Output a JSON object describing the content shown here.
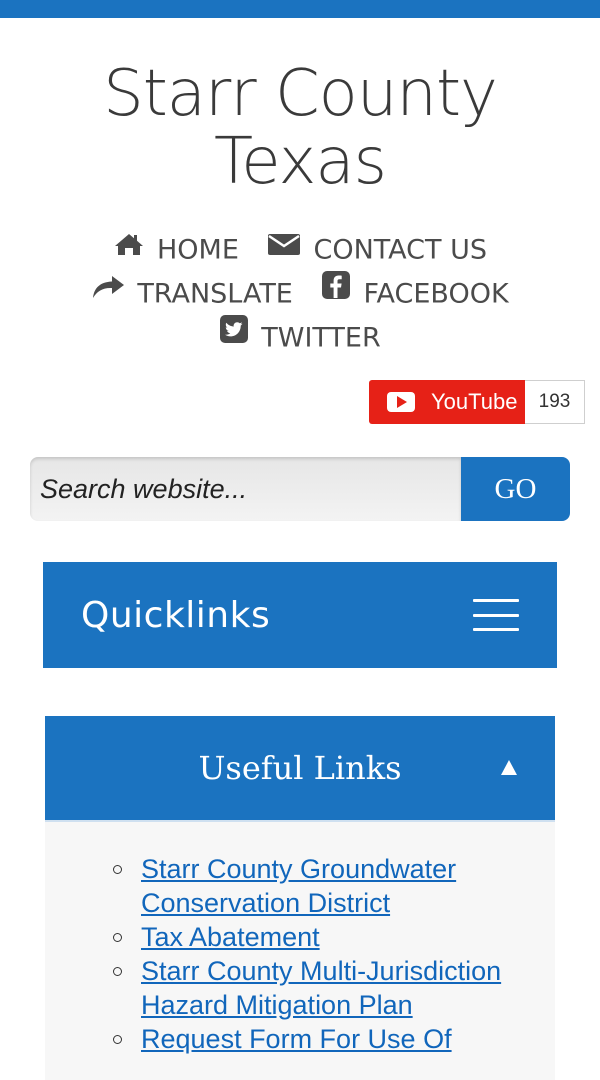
{
  "site": {
    "title_line1": "Starr County",
    "title_line2": "Texas"
  },
  "nav": {
    "home": {
      "label": "HOME",
      "icon": "home-icon"
    },
    "contact": {
      "label": "CONTACT US",
      "icon": "envelope-icon"
    },
    "translate": {
      "label": "TRANSLATE",
      "icon": "share-arrow-icon"
    },
    "facebook": {
      "label": "FACEBOOK",
      "icon": "facebook-icon"
    },
    "twitter": {
      "label": "TWITTER",
      "icon": "twitter-icon"
    }
  },
  "youtube": {
    "label": "YouTube",
    "count": "193",
    "color": "#e62117"
  },
  "search": {
    "placeholder": "Search website...",
    "button_label": "GO"
  },
  "quicklinks": {
    "title": "Quicklinks"
  },
  "useful_links": {
    "title": "Useful Links",
    "items": [
      {
        "label": "Starr County Groundwater Conservation District"
      },
      {
        "label": "Tax Abatement"
      },
      {
        "label": "Starr County Multi-Jurisdiction Hazard Mitigation Plan"
      },
      {
        "label": "Request Form For Use Of"
      }
    ]
  },
  "colors": {
    "primary": "#1b73c0",
    "link": "#1166bb",
    "text": "#4b4b4b"
  }
}
